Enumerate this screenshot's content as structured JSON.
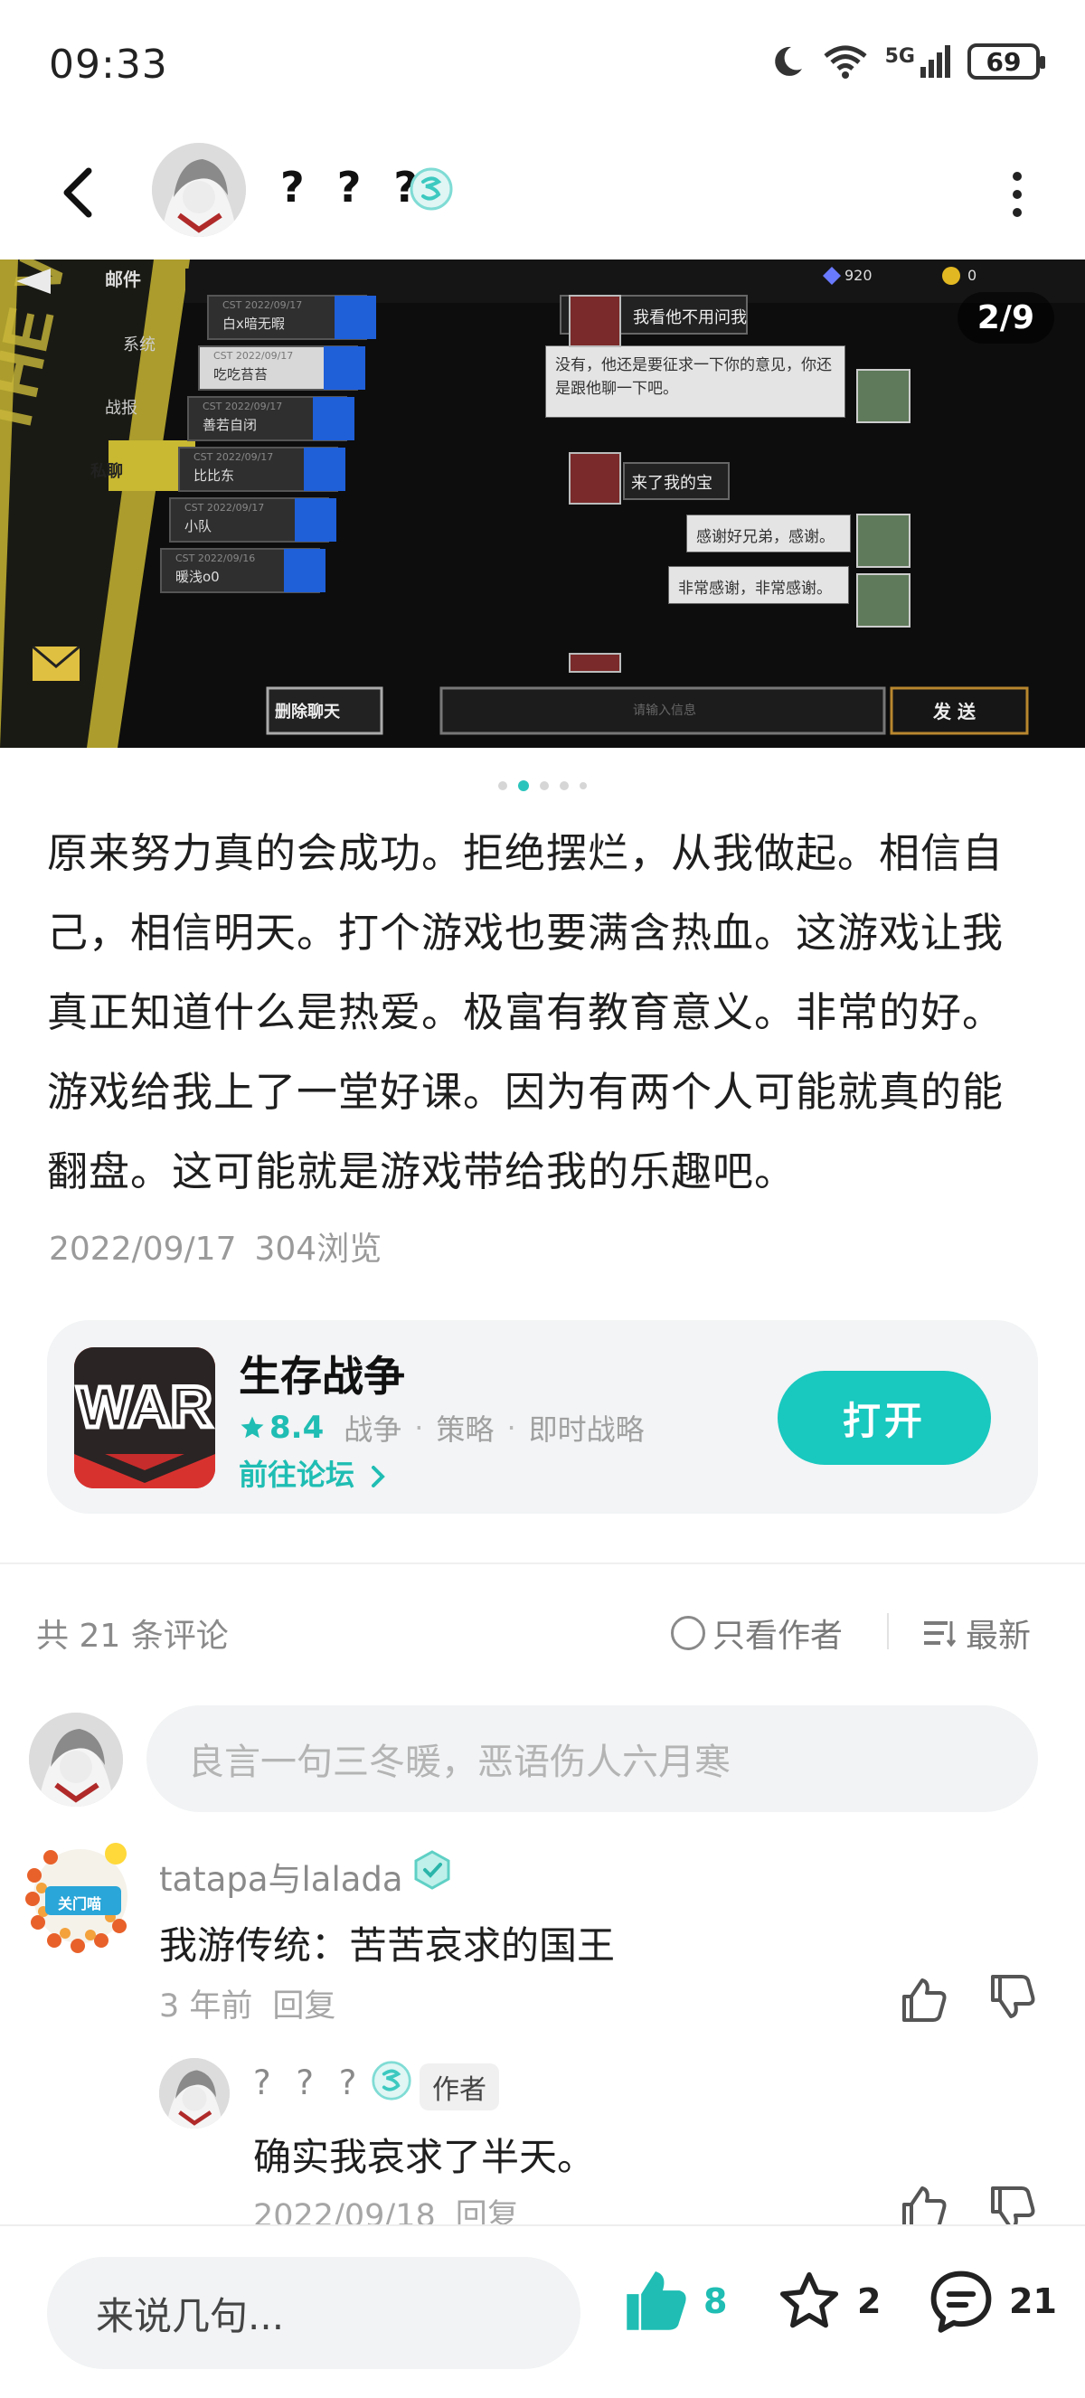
{
  "status": {
    "time": "09:33",
    "battery": "69",
    "network": "5G"
  },
  "header": {
    "user_name": "? ? ?"
  },
  "screenshot": {
    "pager": "2/9",
    "game_ui": {
      "title": "邮件",
      "diamonds": "920",
      "coins": "0",
      "tabs": [
        "系统",
        "战报",
        "私聊"
      ],
      "mail_items": [
        {
          "date": "CST 2022/09/17",
          "name": "白x暗无暇"
        },
        {
          "date": "CST 2022/09/17",
          "name": "吃吃苔苔"
        },
        {
          "date": "CST 2022/09/17",
          "name": "善若自闭"
        },
        {
          "date": "CST 2022/09/17",
          "name": "比比东"
        },
        {
          "date": "CST 2022/09/17",
          "name": "小队"
        },
        {
          "date": "CST 2022/09/16",
          "name": "暖浅o0"
        }
      ],
      "messages": [
        {
          "side": "left",
          "text": "我看他不用问我"
        },
        {
          "side": "right",
          "text": "没有，他还是要征求一下你的意见，你还是跟他聊一下吧。"
        },
        {
          "side": "left",
          "text": "来了我的宝"
        },
        {
          "side": "right",
          "text": "感谢好兄弟，感谢。"
        },
        {
          "side": "right",
          "text": "非常感谢，非常感谢。"
        }
      ],
      "delete_chat": "删除聊天",
      "input_placeholder": "请输入信息",
      "send": "发 送"
    }
  },
  "post": {
    "body": "原来努力真的会成功。拒绝摆烂，从我做起。相信自己，相信明天。打个游戏也要满含热血。这游戏让我真正知道什么是热爱。极富有教育意义。非常的好。游戏给我上了一堂好课。因为有两个人可能就真的能翻盘。这可能就是游戏带给我的乐趣吧。",
    "date": "2022/09/17",
    "views": "304浏览"
  },
  "game_card": {
    "icon_text": "WAR",
    "name": "生存战争",
    "score": "8.4",
    "tags": [
      "战争",
      "策略",
      "即时战略"
    ],
    "forum_link": "前往论坛",
    "open_button": "打开"
  },
  "comments_header": {
    "count": "共 21 条评论",
    "author_only": "只看作者",
    "sort": "最新"
  },
  "comment_input": {
    "placeholder": "良言一句三冬暖，恶语伤人六月寒"
  },
  "comments": [
    {
      "name": "tatapa与lalada",
      "avatar_badge": "关门喵",
      "text": "我游传统：苦苦哀求的国王",
      "time": "3 年前",
      "reply": "回复"
    }
  ],
  "replies": [
    {
      "name": "? ? ?",
      "tag": "作者",
      "text": "确实我哀求了半天。",
      "time": "2022/09/18",
      "reply": "回复"
    }
  ],
  "bottom_bar": {
    "placeholder": "来说几句...",
    "likes": "8",
    "favorites": "2",
    "comments": "21"
  },
  "colors": {
    "accent": "#19c8bf",
    "like": "#1fbdb3",
    "game_icon": "#c0252a"
  }
}
